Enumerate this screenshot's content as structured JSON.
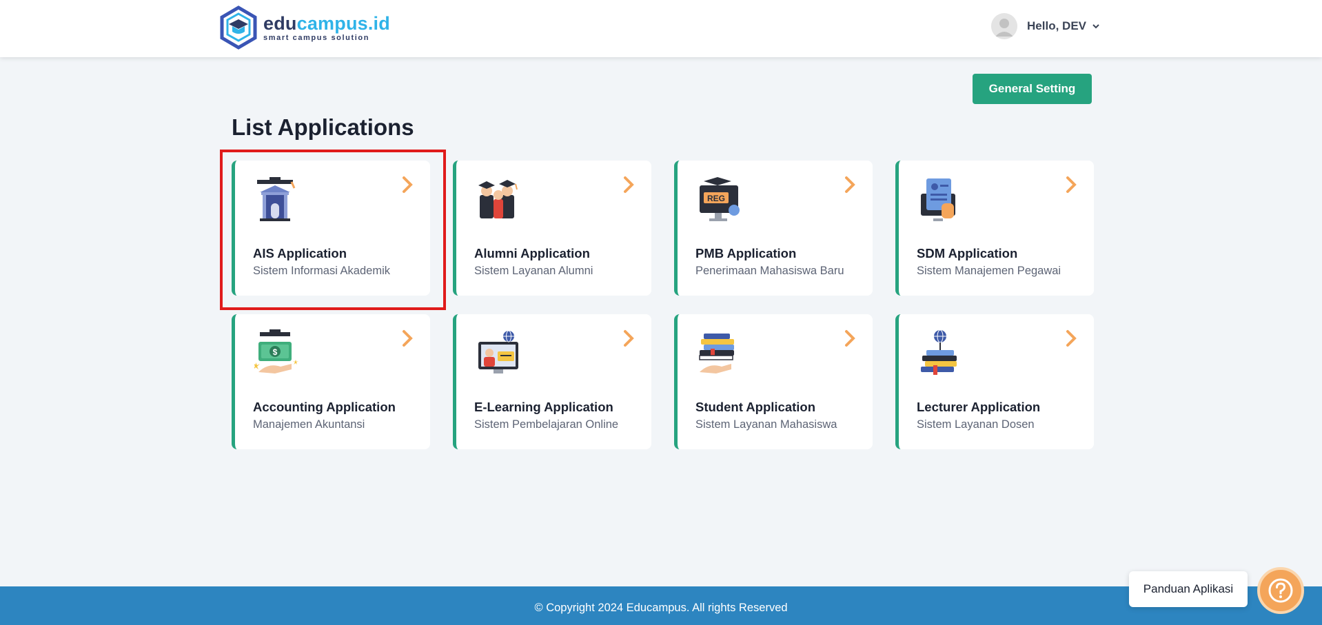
{
  "header": {
    "logo": {
      "part1": "edu",
      "part2": "campus.id",
      "tagline": "smart campus solution"
    },
    "user": {
      "greeting": "Hello, DEV"
    }
  },
  "actions": {
    "general_setting": "General Setting"
  },
  "page": {
    "title": "List Applications"
  },
  "applications": [
    {
      "name": "AIS Application",
      "description": "Sistem Informasi Akademik",
      "icon": "graduation-building-icon"
    },
    {
      "name": "Alumni Application",
      "description": "Sistem Layanan Alumni",
      "icon": "alumni-graduates-icon"
    },
    {
      "name": "PMB Application",
      "description": "Penerimaan Mahasiswa Baru",
      "icon": "registration-monitor-icon"
    },
    {
      "name": "SDM Application",
      "description": "Sistem Manajemen Pegawai",
      "icon": "employee-document-icon"
    },
    {
      "name": "Accounting Application",
      "description": "Manajemen Akuntansi",
      "icon": "money-hand-icon"
    },
    {
      "name": "E-Learning Application",
      "description": "Sistem Pembelajaran Online",
      "icon": "online-learning-icon"
    },
    {
      "name": "Student Application",
      "description": "Sistem Layanan Mahasiswa",
      "icon": "books-hand-icon"
    },
    {
      "name": "Lecturer Application",
      "description": "Sistem Layanan Dosen",
      "icon": "books-globe-icon"
    }
  ],
  "footer": {
    "copyright": "© Copyright 2024 Educampus. All rights Reserved"
  },
  "help": {
    "label": "Panduan Aplikasi"
  },
  "colors": {
    "accent": "#26a37f",
    "footer": "#2d85c0",
    "arrow": "#f4a55a",
    "highlight": "#e01b1b"
  }
}
